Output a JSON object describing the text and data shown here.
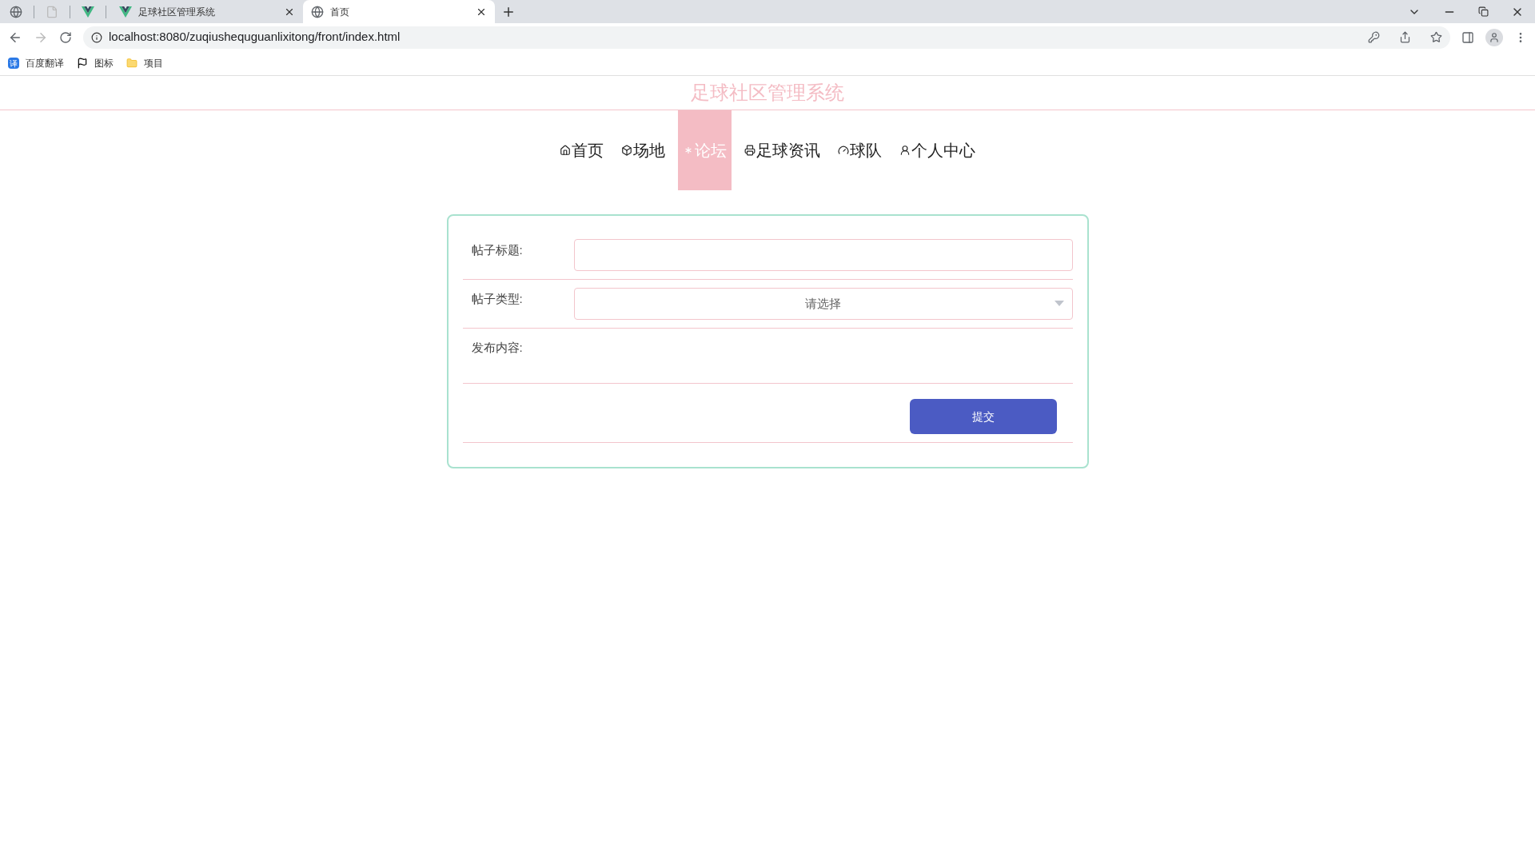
{
  "browser": {
    "tabs": [
      {
        "label": "足球社区管理系统",
        "selected": false
      },
      {
        "label": "首页",
        "selected": true
      }
    ],
    "url": "localhost:8080/zuqiushequguanlixitong/front/index.html",
    "bookmarks": [
      {
        "label": "百度翻译",
        "glyph": "译"
      },
      {
        "label": "图标"
      },
      {
        "label": "项目"
      }
    ]
  },
  "header": {
    "title": "足球社区管理系统"
  },
  "nav": [
    {
      "label": "首页",
      "selected": false
    },
    {
      "label": "场地",
      "selected": false
    },
    {
      "label": "论坛",
      "selected": true
    },
    {
      "label": "足球资讯",
      "selected": false
    },
    {
      "label": "球队",
      "selected": false
    },
    {
      "label": "个人中心",
      "selected": false
    }
  ],
  "form": {
    "fields": [
      {
        "kind": "text",
        "label": "帖子标题:"
      },
      {
        "kind": "select",
        "label": "帖子类型:",
        "placeholder": "请选择"
      },
      {
        "kind": "content",
        "label": "发布内容:"
      }
    ],
    "submit": "提交"
  }
}
